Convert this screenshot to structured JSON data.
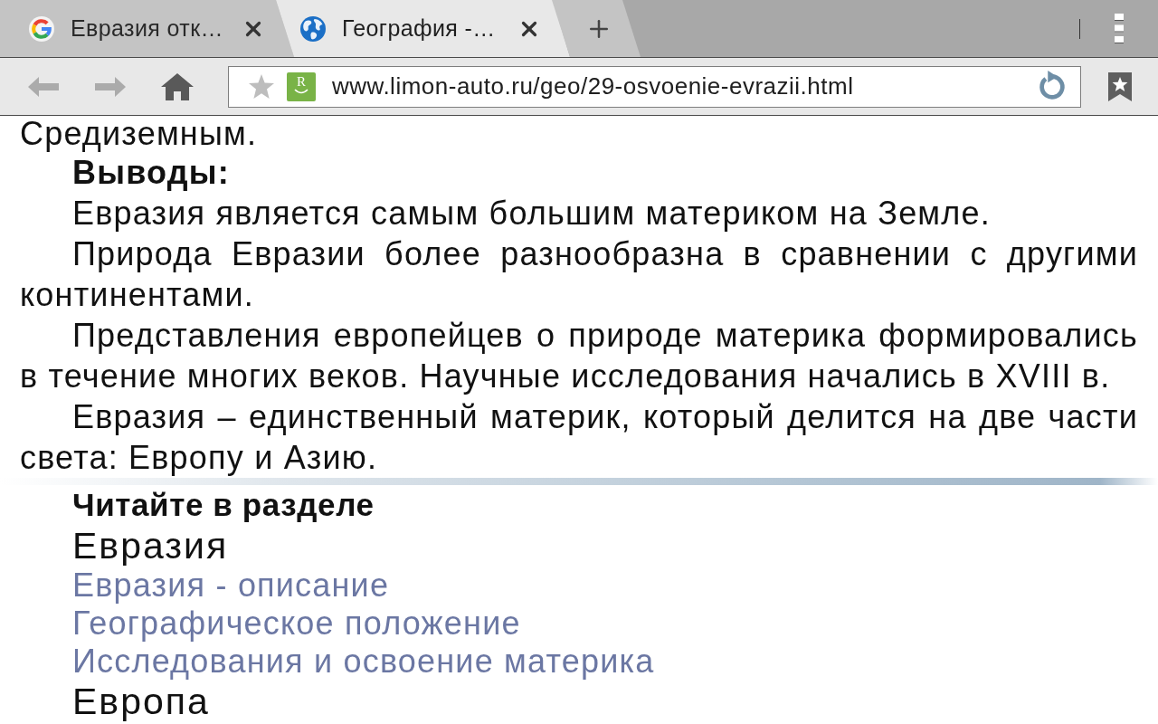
{
  "tabs": [
    {
      "kind": "search",
      "title": "Евразия отк…",
      "selected": false
    },
    {
      "kind": "web",
      "title": "География -…",
      "selected": true
    }
  ],
  "toolbar": {
    "nav_buttons": [
      {
        "kind": "back",
        "disabled": true
      },
      {
        "kind": "forward",
        "disabled": true
      },
      {
        "kind": "home",
        "disabled": false
      }
    ],
    "address_bar": {
      "bookmarked": false,
      "reader_badge": "R",
      "url": "www.limon-auto.ru/geo/29-osvoenie-evrazii.html"
    }
  },
  "article": {
    "paragraphs": [
      {
        "kind": "continuation",
        "text": "Средиземным."
      },
      {
        "kind": "heading",
        "text": "Выводы:"
      },
      {
        "kind": "body",
        "text": "Евразия является самым большим материком на Земле."
      },
      {
        "kind": "body",
        "text": "Природа Евразии более разнообразна в сравнении с другими континентами."
      },
      {
        "kind": "body",
        "text": "Представления европейцев о природе материка формировались в течение многих веков. Научные исследования начались в XVIII в."
      },
      {
        "kind": "body",
        "text": "Евразия – единственный материк, который делится на две части света: Европу и Азию."
      }
    ]
  },
  "related": {
    "heading": "Читайте в разделе",
    "groups": [
      {
        "title": "Евразия",
        "links": [
          "Евразия - описание",
          "Географическое положение",
          "Исследования и освоение материка"
        ]
      },
      {
        "title": "Европа"
      }
    ]
  }
}
